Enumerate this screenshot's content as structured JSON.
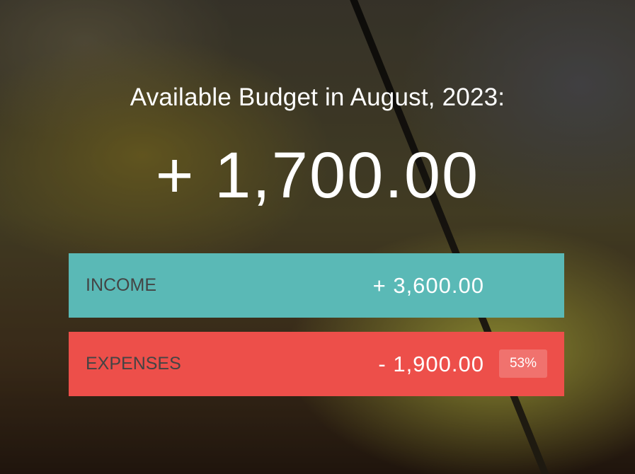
{
  "budget": {
    "title": "Available Budget in August, 2023:",
    "value": "+ 1,700.00"
  },
  "income": {
    "label": "INCOME",
    "value": "+ 3,600.00",
    "color": "#5ab9b6"
  },
  "expenses": {
    "label": "EXPENSES",
    "value": "- 1,900.00",
    "percentage": "53%",
    "color": "#ed4f4a"
  }
}
